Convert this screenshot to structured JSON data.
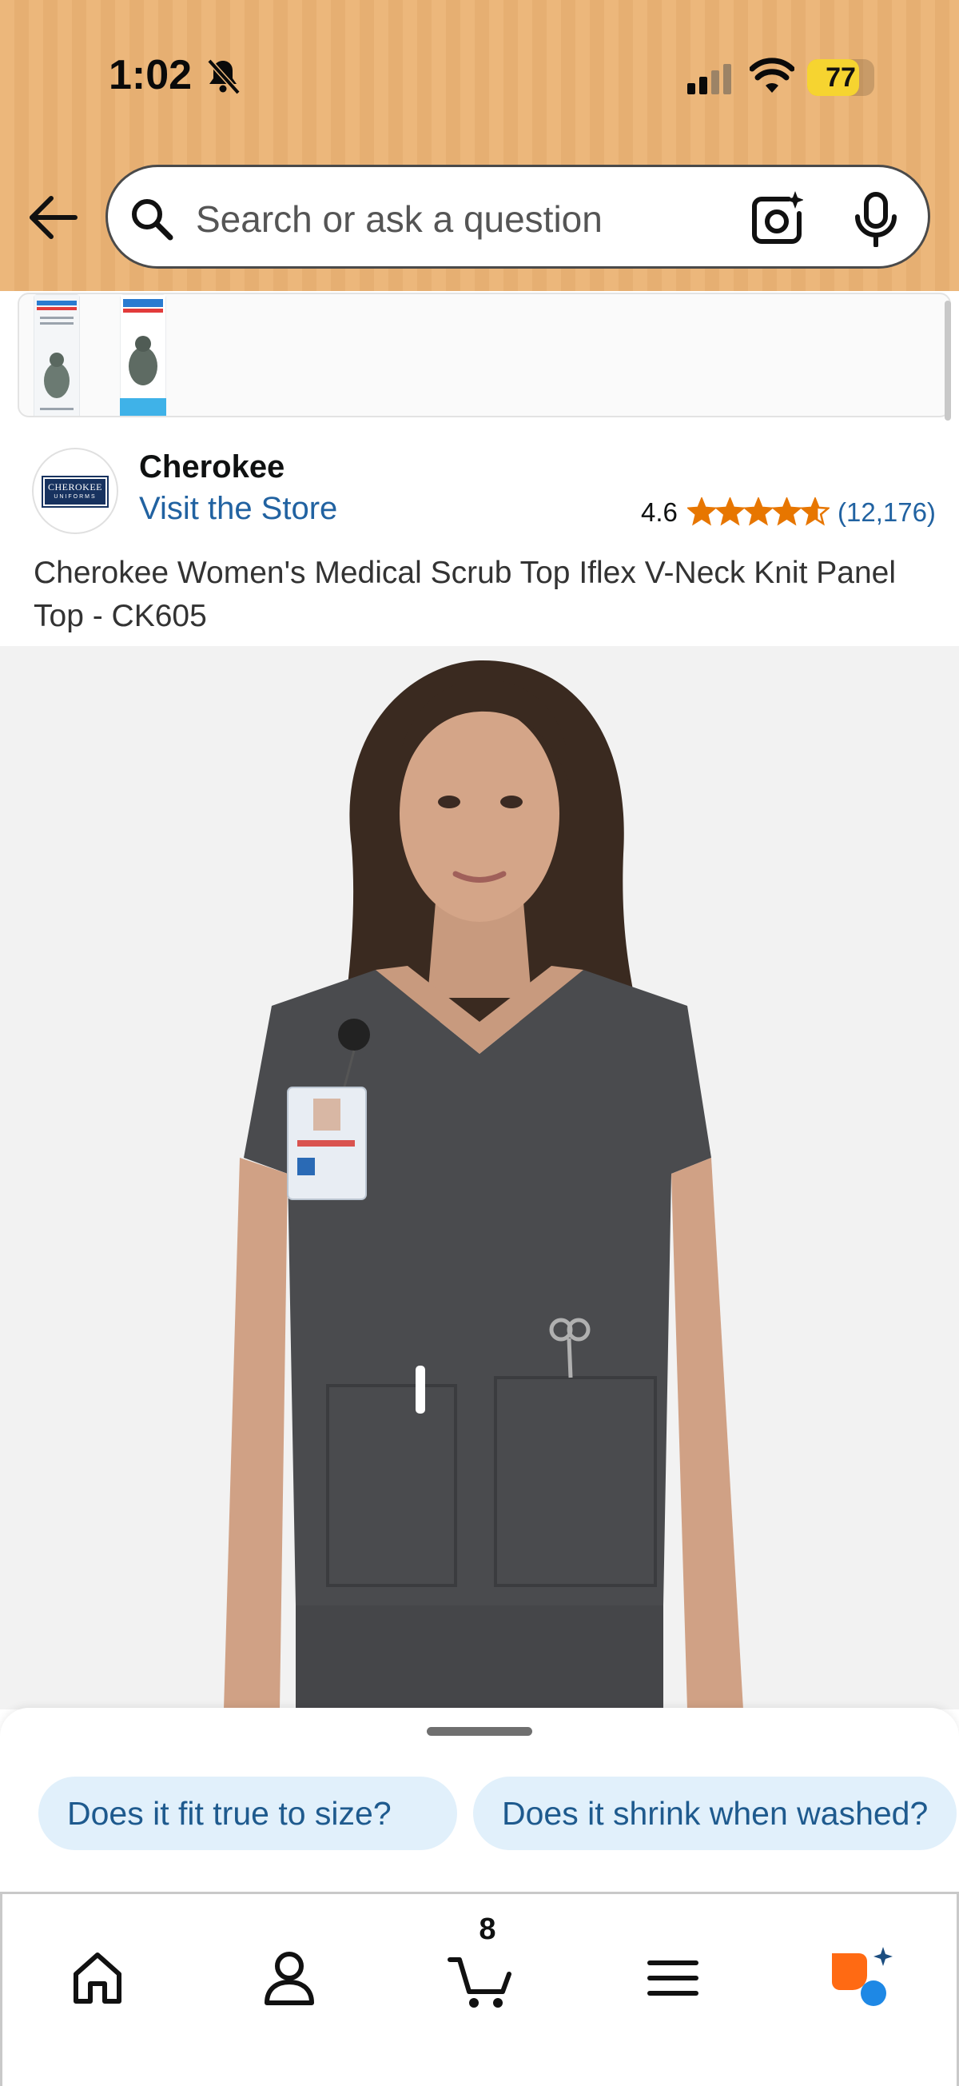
{
  "status_bar": {
    "time": "1:02",
    "battery_level": "77",
    "battery_fraction": 0.77,
    "battery_color": "#f6d430",
    "icons": [
      "bell-muted-icon",
      "cellular-signal-icon",
      "wifi-icon",
      "battery-icon"
    ]
  },
  "header": {
    "back_icon": "back-arrow-icon",
    "search": {
      "placeholder": "Search or ask a question",
      "icons": [
        "search-icon",
        "camera-icon",
        "mic-icon"
      ]
    },
    "background_color": "#ecb77b"
  },
  "sponsored": {
    "items": [
      "ointment-product-1",
      "diaper-rash-ointment-product-2"
    ]
  },
  "brand": {
    "name": "Cherokee",
    "store_link": "Visit the Store",
    "logo_text": "CHEROKEE",
    "logo_sub": "UNIFORMS",
    "rating": "4.6",
    "stars": 4.6,
    "review_count": "(12,176)",
    "star_color": "#e77600",
    "link_color": "#2162a1"
  },
  "product": {
    "title": "Cherokee Women's Medical Scrub Top Iflex V-Neck Knit Panel Top - CK605",
    "image_color": "#4a4b4e"
  },
  "suggestions": {
    "chips": [
      "Does it fit true to size?",
      "Does it shrink when washed?"
    ]
  },
  "tabbar": {
    "tabs": [
      "home",
      "account",
      "cart",
      "menu",
      "rufus"
    ],
    "cart_count": "8"
  }
}
